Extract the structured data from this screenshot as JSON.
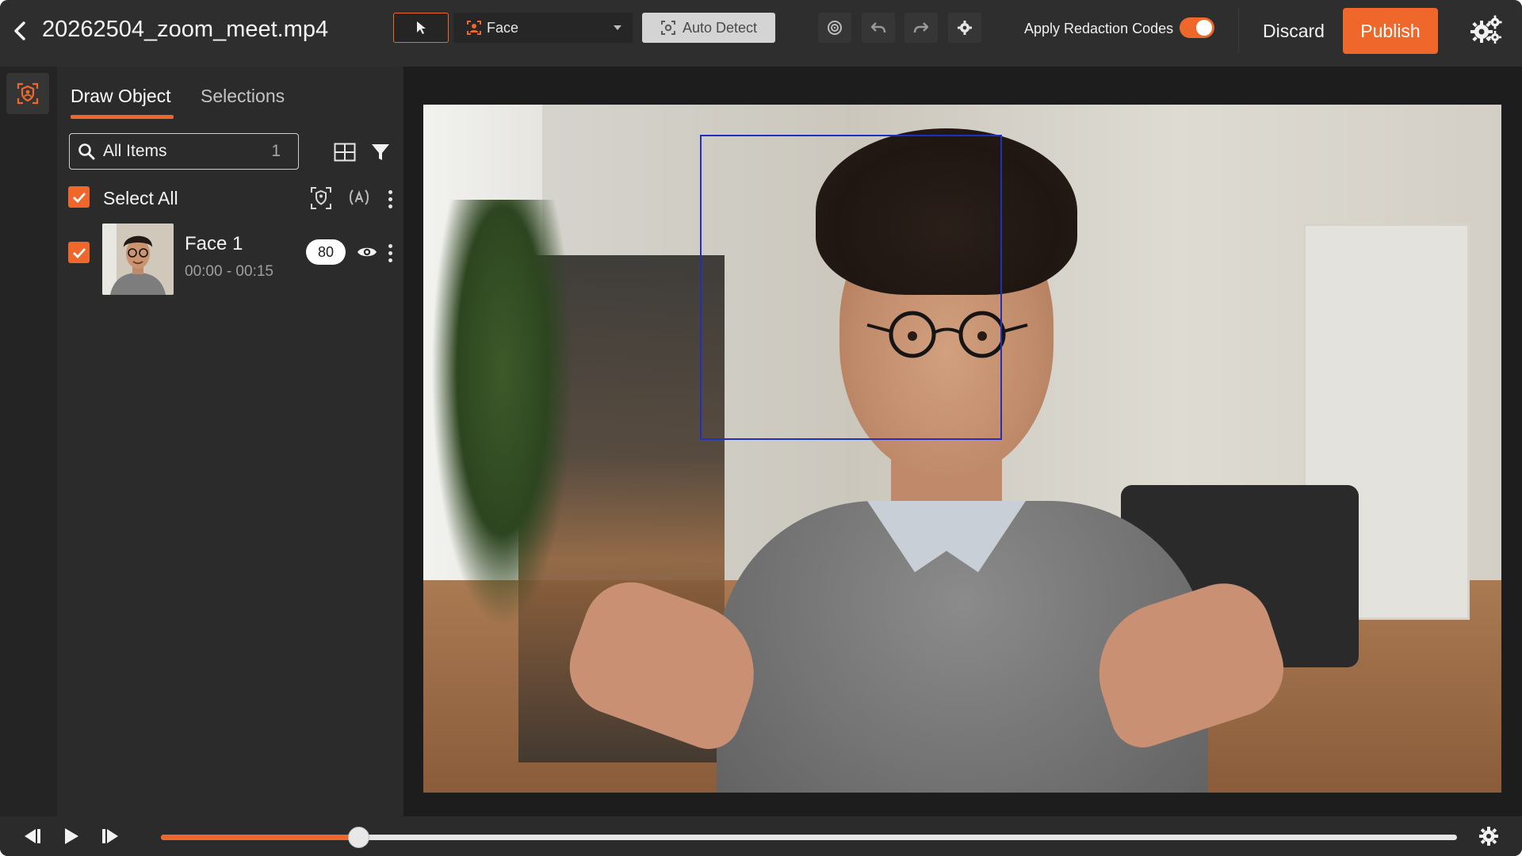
{
  "header": {
    "filename": "20262504_zoom_meet.mp4",
    "tool_dropdown": {
      "selected": "Face",
      "icon": "face-detect-icon"
    },
    "auto_detect_label": "Auto Detect",
    "redaction_toggle": {
      "label": "Apply Redaction Codes",
      "on": true
    },
    "discard_label": "Discard",
    "publish_label": "Publish",
    "accent_color": "#f0672b",
    "icons": [
      "back-arrow-icon",
      "cursor-arrow-icon",
      "face-detect-icon",
      "auto-detect-icon",
      "target-icon",
      "undo-icon",
      "redo-icon",
      "gear-icon",
      "settings-gears-icon"
    ]
  },
  "panel": {
    "tabs": [
      {
        "label": "Draw Object",
        "active": true
      },
      {
        "label": "Selections",
        "active": false
      }
    ],
    "search": {
      "value": "All Items",
      "count": "1"
    },
    "select_all": {
      "label": "Select All",
      "checked": true
    },
    "items": [
      {
        "name": "Face 1",
        "time": "00:00 - 00:15",
        "confidence": "80",
        "checked": true,
        "visible": true
      }
    ]
  },
  "stage": {
    "bounding_box_color": "#1f2fc2"
  },
  "player": {
    "progress_fraction": 0.152,
    "controls": [
      "step-back-icon",
      "play-icon",
      "step-forward-icon",
      "player-settings-icon"
    ]
  }
}
